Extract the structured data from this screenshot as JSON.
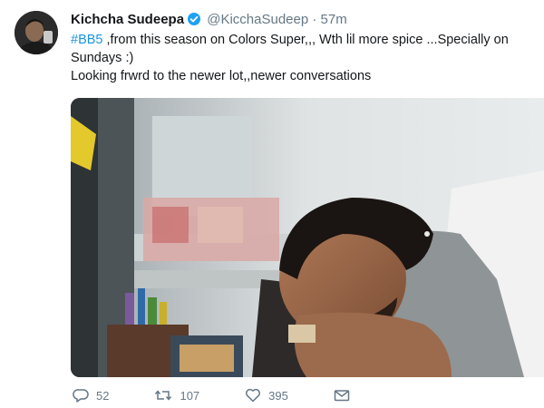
{
  "tweet": {
    "author_name": "Kichcha Sudeepa",
    "author_handle": "@KicchaSudeep",
    "separator": "·",
    "time": "57m",
    "hashtag": "#BB5",
    "line1_rest": " ,from this season on Colors Super,,, Wth lil more spice ...Specially on Sundays  :)",
    "line2": "Looking frwrd to the newer lot,,newer conversations",
    "replies": "52",
    "retweets": "107",
    "likes": "395"
  },
  "icons": {
    "verified": "verified-badge-icon",
    "reply": "reply-icon",
    "retweet": "retweet-icon",
    "like": "heart-icon",
    "message": "envelope-icon"
  },
  "colors": {
    "link": "#1b95e0",
    "verified": "#1da1f2",
    "muted": "#657786"
  }
}
